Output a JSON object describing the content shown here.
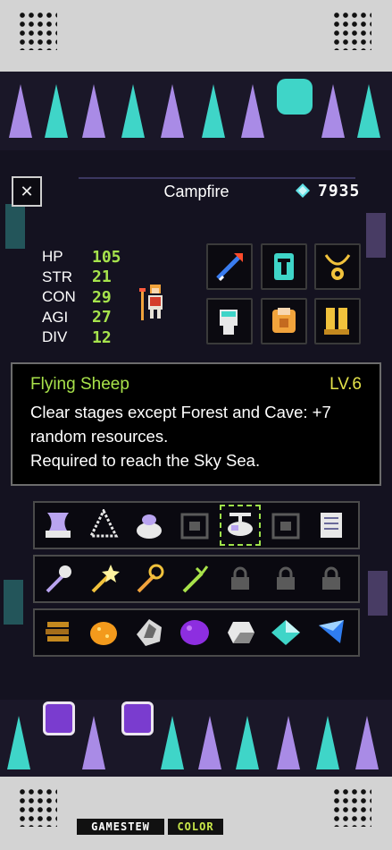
{
  "header": {
    "title": "Campfire",
    "gem_count": "7935"
  },
  "stats": [
    {
      "label": "HP",
      "value": "105"
    },
    {
      "label": "STR",
      "value": "21"
    },
    {
      "label": "CON",
      "value": "29"
    },
    {
      "label": "AGI",
      "value": "27"
    },
    {
      "label": "DIV",
      "value": "12"
    }
  ],
  "equipment": [
    {
      "name": "spear-icon"
    },
    {
      "name": "helmet-icon"
    },
    {
      "name": "amulet-icon"
    },
    {
      "name": "gauntlet-icon"
    },
    {
      "name": "armor-icon"
    },
    {
      "name": "boots-icon"
    }
  ],
  "tooltip": {
    "name": "Flying Sheep",
    "level": "LV.6",
    "line1": "Clear stages except Forest and Cave: +7",
    "line2": "random resources.",
    "line3": "Required to reach the Sky Sea."
  },
  "inventory": {
    "row1": [
      "ship-icon",
      "net-icon",
      "cauldron-icon",
      "crate-locked-icon",
      "flying-sheep-icon",
      "crate-locked-icon",
      "scroll-icon"
    ],
    "row2": [
      "skull-staff-icon",
      "star-wand-icon",
      "key-staff-icon",
      "trident-icon",
      "lock-icon",
      "lock-icon",
      "lock-icon"
    ],
    "row3": [
      "wood-icon",
      "orange-ore-icon",
      "stone-ore-icon",
      "purple-ore-icon",
      "silver-ore-icon",
      "cyan-gem-icon",
      "blue-gem-icon"
    ]
  },
  "footer": {
    "logo_left": "GAMESTEW",
    "logo_right": "COLOR"
  },
  "colors": {
    "accent_green": "#a8e24a",
    "level_yellow": "#e4e34a",
    "tree_violet": "#a98be6",
    "tree_cyan": "#3fd5c8"
  }
}
